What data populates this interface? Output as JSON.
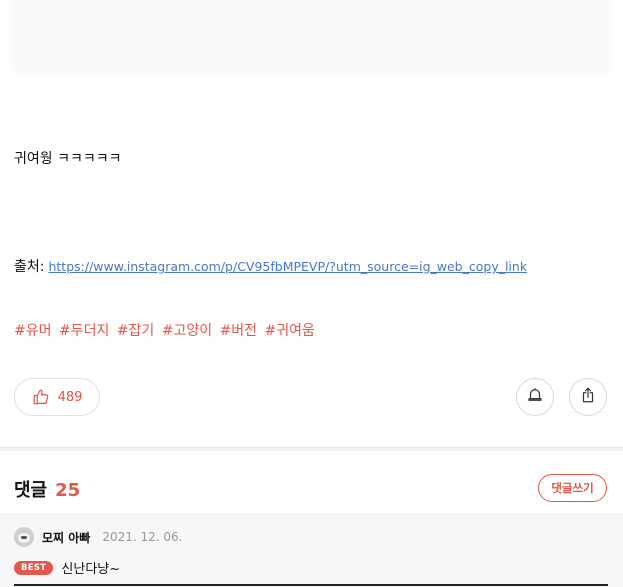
{
  "post": {
    "body_text": "귀여웡 ㅋㅋㅋㅋㅋ",
    "source_label": "출처:",
    "source_link": "https://www.instagram.com/p/CV95fbMPEVP/?utm_source=ig_web_copy_link",
    "tags": [
      "#유머",
      "#두더지",
      "#잡기",
      "#고양이",
      "#버전",
      "#귀여움"
    ]
  },
  "actions": {
    "like_count": "489",
    "like_icon": "thumbs-up-icon",
    "bell_icon": "bell-icon",
    "share_icon": "share-icon"
  },
  "comments": {
    "title": "댓글",
    "count": "25",
    "write_label": "댓글쓰기",
    "items": [
      {
        "author": "모찌 아빠",
        "date": "2021. 12. 06.",
        "badge": "BEST",
        "text": "신난다냥~"
      }
    ]
  },
  "colors": {
    "accent": "#e2574c",
    "link": "#4878c8",
    "comment_bg": "#f7f7f7"
  }
}
